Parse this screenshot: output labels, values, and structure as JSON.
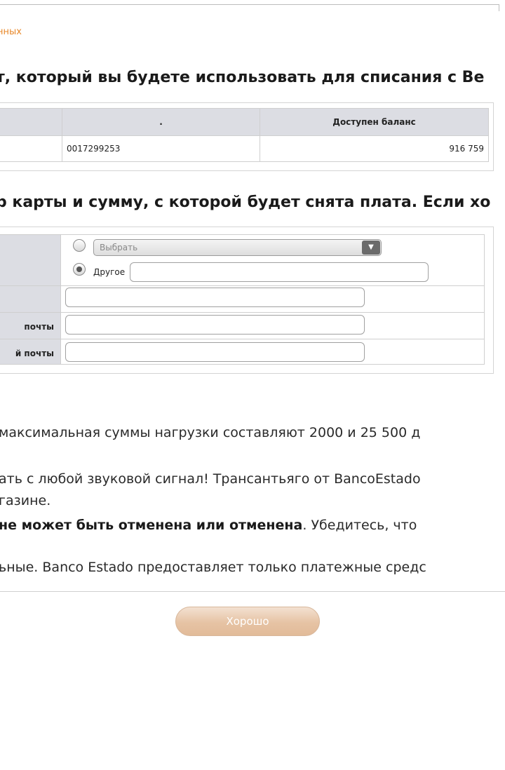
{
  "breadcrumb": "нных",
  "section1": {
    "heading": "т, который вы будете использовать для списания с Ве"
  },
  "accounts_table": {
    "headers": [
      "",
      ".",
      "Доступен баланс"
    ],
    "rows": [
      {
        "number": "0017299253",
        "balance": "916 759"
      }
    ]
  },
  "section2": {
    "heading": "р карты и сумму, с которой будет снята плата. Если хо"
  },
  "form": {
    "select_placeholder": "Выбрать",
    "other_label": "Другое",
    "email_label": "почты",
    "email_confirm_label": "й почты",
    "other_value": "",
    "amount_value": "",
    "email_value": "",
    "email_confirm_value": ""
  },
  "notes": {
    "line1": "максимальная суммы нагрузки составляют 2000 и 25 500 д",
    "line2a": "ать с любой звуковой сигнал! Трансантьяго от BancoEstado",
    "line2b": "газине.",
    "line3_bold": "не может быть отменена или отменена",
    "line3_rest": ". Убедитесь, что",
    "line4": "ьные. Banco Estado предоставляет только платежные средс"
  },
  "ok_button_label": "Хорошо",
  "colors": {
    "breadcrumb": "#e8892b",
    "header_bg": "#dcdde3",
    "button_bg": "#e6c3a4"
  }
}
